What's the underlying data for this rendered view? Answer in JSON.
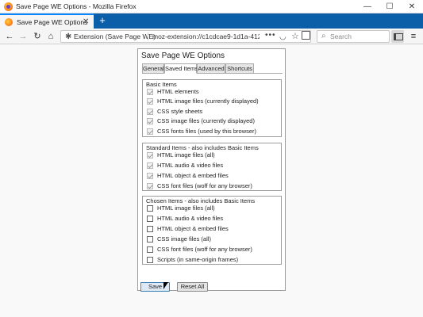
{
  "window": {
    "title": "Save Page WE Options - Mozilla Firefox",
    "controls": {
      "minimize": "—",
      "maximize": "☐",
      "close": "✕"
    }
  },
  "tabs": [
    {
      "label": "Save Page WE Options",
      "close": "✕",
      "active": true
    }
  ],
  "new_tab": "+",
  "navbar": {
    "back": "←",
    "forward": "→",
    "reload": "↻",
    "home": "⌂",
    "identity_label": "Extension (Save Page WE)",
    "url": "moz-extension://c1cdcae9-1d1a-412",
    "page_actions": "•••",
    "search_placeholder": "Search",
    "menu": "≡"
  },
  "options": {
    "title": "Save Page WE Options",
    "tabs": [
      "General",
      "Saved Items",
      "Advanced",
      "Shortcuts"
    ],
    "active_tab": "Saved Items",
    "groups": {
      "basic": {
        "legend": "Basic Items",
        "items": [
          {
            "label": "HTML elements",
            "checked": true,
            "disabled": true
          },
          {
            "label": "HTML image files (currently displayed)",
            "checked": true,
            "disabled": true
          },
          {
            "label": "CSS style sheets",
            "checked": true,
            "disabled": true
          },
          {
            "label": "CSS image files (currently displayed)",
            "checked": true,
            "disabled": true
          },
          {
            "label": "CSS fonts files (used by this browser)",
            "checked": true,
            "disabled": true
          }
        ]
      },
      "standard": {
        "legend": "Standard Items - also includes Basic Items",
        "items": [
          {
            "label": "HTML image files (all)",
            "checked": true,
            "disabled": true
          },
          {
            "label": "HTML audio & video files",
            "checked": true,
            "disabled": true
          },
          {
            "label": "HTML object & embed files",
            "checked": true,
            "disabled": true
          },
          {
            "label": "CSS font files (woff for any browser)",
            "checked": true,
            "disabled": true
          }
        ]
      },
      "chosen": {
        "legend": "Chosen Items - also includes Basic Items",
        "items": [
          {
            "label": "HTML image files (all)",
            "checked": false,
            "disabled": false
          },
          {
            "label": "HTML audio & video files",
            "checked": false,
            "disabled": false
          },
          {
            "label": "HTML object & embed files",
            "checked": false,
            "disabled": false
          },
          {
            "label": "CSS image files (all)",
            "checked": false,
            "disabled": false
          },
          {
            "label": "CSS font files (woff for any browser)",
            "checked": false,
            "disabled": false
          },
          {
            "label": "Scripts (in same-origin frames)",
            "checked": false,
            "disabled": false
          }
        ]
      }
    },
    "buttons": {
      "save": "Save",
      "reset": "Reset All"
    }
  }
}
